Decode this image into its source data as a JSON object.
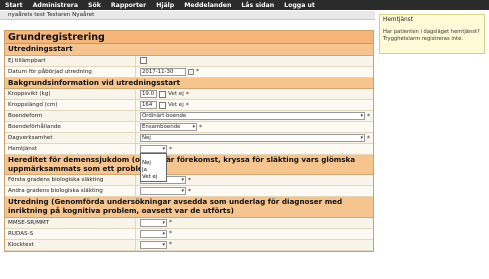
{
  "menu": [
    "Start",
    "Administrera",
    "Sök",
    "Rapporter",
    "Hjälp",
    "Meddelanden",
    "Lås sidan",
    "Logga ut"
  ],
  "patient_bar": "nyaårets test Testaren Nyaåret",
  "form": {
    "title": "Grundregistrering",
    "sections": {
      "utredningsstart": "Utredningsstart",
      "bakgrund": "Bakgrundsinformation vid utredningsstart",
      "hereditet": "Hereditet för demenssjukdom (om det är förekomst, kryssa för släkting vars glömska uppmärksammats som ett problem)",
      "utredning": "Utredning (Genomförda undersökningar avsedda som underlag för diagnoser med inriktning på kognitiva problem, oavsett var de utförts)"
    },
    "labels": {
      "ej_tillampbart": "Ej tillämpbart",
      "datum": "Datum för påbörjad utredning",
      "kroppsvikt": "Kroppsvikt (kg)",
      "kroppslangd": "Kroppslängd (cm)",
      "boendeform": "Boendeform",
      "boendeforhallande": "Boendeförhållande",
      "dagverksamhet": "Dagverksamhet",
      "hemtjanst": "Hemtjänst",
      "forsta_grad": "Första gradens biologiska släkting",
      "andra_grad": "Andra gradens biologiska släkting",
      "mmse": "MMSE-SR/MMT",
      "rudas": "RUDAS-S",
      "klocktest": "Klocktest"
    },
    "values": {
      "datum": "2017-11-30",
      "kroppsvikt": "19.0",
      "kroppslangd": "164",
      "boendeform": "Ordinärt boende",
      "boendeforhallande": "Ensamboende",
      "dagverksamhet": "Nej",
      "hemtjanst": ""
    },
    "vet_ej": "Vet ej",
    "star": "*",
    "hemtjanst_options": [
      "Nej",
      "Ja",
      "Vet ej"
    ]
  },
  "infobox": {
    "title": "Hemtjänst",
    "text": "Har patienten i dagsläget hemtjänst? Trygghetslarm registreras inte."
  }
}
